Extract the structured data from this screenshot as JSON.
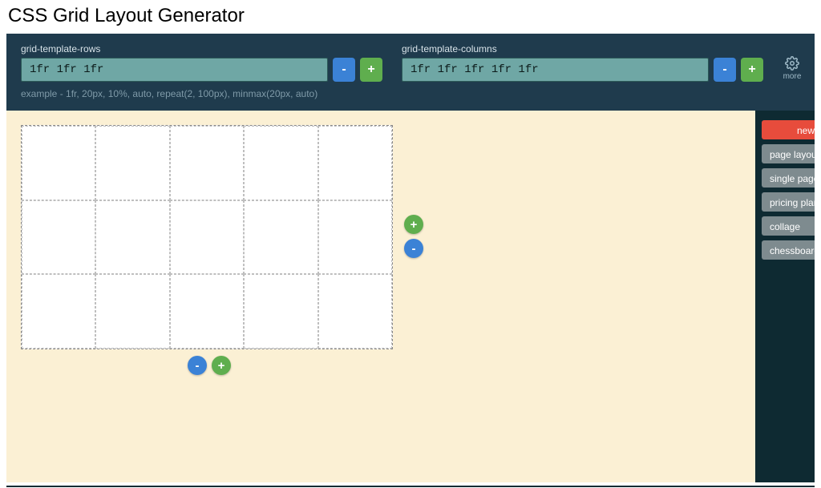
{
  "title": "CSS Grid Layout Generator",
  "topbar": {
    "rows": {
      "label": "grid-template-rows",
      "value": "1fr 1fr 1fr",
      "minus": "-",
      "plus": "+"
    },
    "cols": {
      "label": "grid-template-columns",
      "value": "1fr 1fr 1fr 1fr 1fr",
      "minus": "-",
      "plus": "+"
    },
    "example": "example - 1fr, 20px, 10%, auto, repeat(2, 100px), minmax(20px, auto)",
    "more_label": "more"
  },
  "preview": {
    "rows": 3,
    "cols": 5,
    "side": {
      "plus": "+",
      "minus": "-"
    },
    "bottom": {
      "plus": "+",
      "minus": "-"
    }
  },
  "sidebar": {
    "buttons": [
      {
        "label": "new",
        "variant": "primary"
      },
      {
        "label": "page layout",
        "variant": "muted"
      },
      {
        "label": "single page",
        "variant": "muted"
      },
      {
        "label": "pricing plan",
        "variant": "muted"
      },
      {
        "label": "collage",
        "variant": "muted"
      },
      {
        "label": "chessboard",
        "variant": "muted"
      }
    ]
  }
}
